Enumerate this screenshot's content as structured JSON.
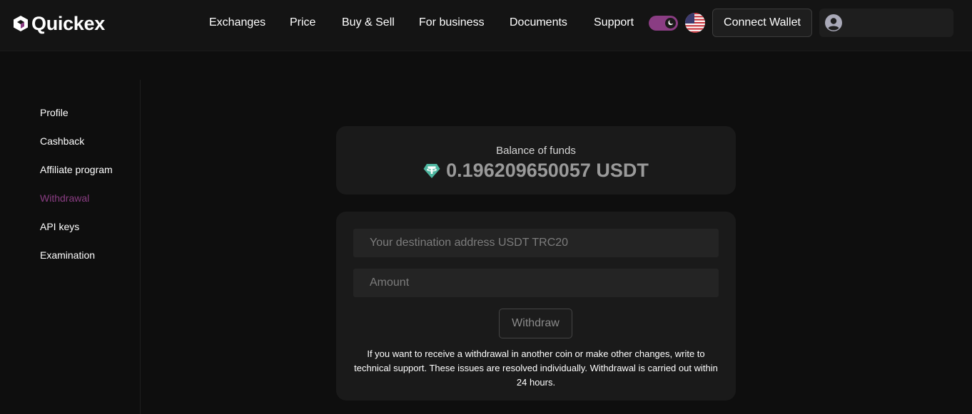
{
  "brand": {
    "name": "Quickex"
  },
  "nav": [
    {
      "label": "Exchanges"
    },
    {
      "label": "Price"
    },
    {
      "label": "Buy & Sell"
    },
    {
      "label": "For business"
    },
    {
      "label": "Documents"
    },
    {
      "label": "Support"
    }
  ],
  "header": {
    "connect_wallet_label": "Connect Wallet",
    "theme_toggle": {
      "state": "dark",
      "accent": "#8a3d83"
    },
    "language_flag": "us-flag-icon"
  },
  "sidebar": {
    "items": [
      {
        "label": "Profile"
      },
      {
        "label": "Cashback"
      },
      {
        "label": "Affiliate program"
      },
      {
        "label": "Withdrawal",
        "active": true
      },
      {
        "label": "API keys"
      },
      {
        "label": "Examination"
      }
    ]
  },
  "balance": {
    "label": "Balance of funds",
    "value": "0.196209650057 USDT",
    "icon": "tether-icon"
  },
  "form": {
    "address_placeholder": "Your destination address USDT TRC20",
    "amount_placeholder": "Amount",
    "withdraw_label": "Withdraw",
    "note": "If you want to receive a withdrawal in another coin or make other changes, write to technical support. These issues are resolved individually. Withdrawal is carried out within 24 hours."
  },
  "colors": {
    "background": "#0e0e0e",
    "header": "#141414",
    "card": "#1a1a1a",
    "accent": "#8a3d83",
    "tether": "#4db6a0"
  }
}
